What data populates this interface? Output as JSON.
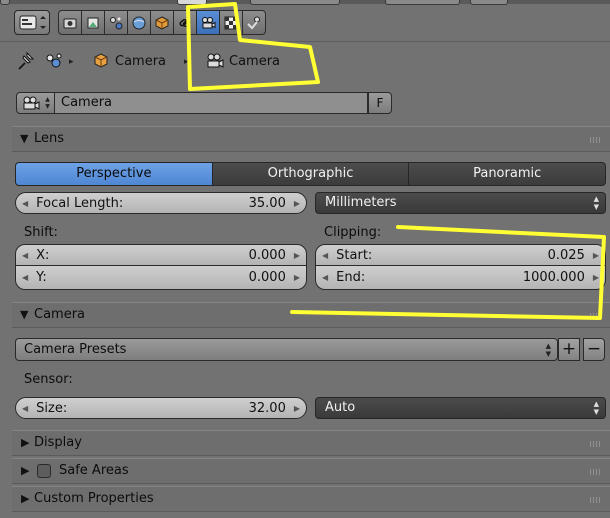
{
  "context_tabs": [
    "render-icon",
    "scene-icon",
    "world-icon",
    "object-icon",
    "constraints-icon",
    "object-data-icon",
    "material-icon",
    "texture-icon",
    "physics-icon"
  ],
  "breadcrumb": {
    "object": "Camera",
    "data": "Camera"
  },
  "datablock": {
    "name": "Camera",
    "fake_user": "F"
  },
  "lens": {
    "title": "Lens",
    "tabs": [
      "Perspective",
      "Orthographic",
      "Panoramic"
    ],
    "active_tab": "Perspective",
    "focal_length": {
      "label": "Focal Length:",
      "value": "35.00"
    },
    "lens_unit": "Millimeters",
    "shift": {
      "label": "Shift:",
      "x_label": "X:",
      "x_value": "0.000",
      "y_label": "Y:",
      "y_value": "0.000"
    },
    "clipping": {
      "label": "Clipping:",
      "start_label": "Start:",
      "start_value": "0.025",
      "end_label": "End:",
      "end_value": "1000.000"
    }
  },
  "camera": {
    "title": "Camera",
    "presets": "Camera Presets",
    "add": "+",
    "remove": "−",
    "sensor_label": "Sensor:",
    "size_label": "Size:",
    "size_value": "32.00",
    "fit": "Auto"
  },
  "collapsed_panels": {
    "display": "Display",
    "safe_areas": "Safe Areas",
    "custom_properties": "Custom Properties"
  },
  "colors": {
    "background": "#727272",
    "accent": "#5a8fd6",
    "annotation": "#ffff33"
  }
}
